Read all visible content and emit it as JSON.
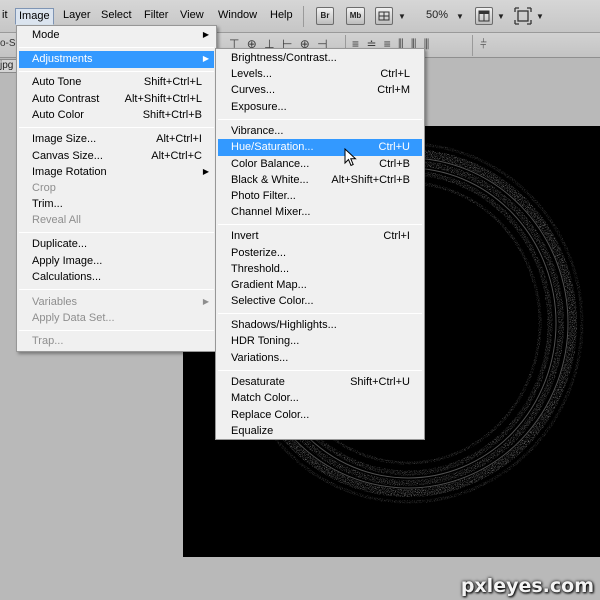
{
  "menubar": {
    "items": [
      "it",
      "Image",
      "Layer",
      "Select",
      "Filter",
      "View",
      "Window",
      "Help"
    ],
    "bridge_label": "Br",
    "minibridge_label": "Mb",
    "zoom": "50%"
  },
  "options_bar": {
    "left_fragment": "o-Se"
  },
  "doc_tab": {
    "label": "jpg"
  },
  "image_menu": {
    "rows": [
      {
        "label": "Mode",
        "shortcut": "",
        "submenu": true,
        "disabled": false,
        "highlighted": false
      },
      {
        "label": "Adjustments",
        "shortcut": "",
        "submenu": true,
        "disabled": false,
        "highlighted": true
      },
      {
        "label": "Auto Tone",
        "shortcut": "Shift+Ctrl+L",
        "submenu": false,
        "disabled": false,
        "highlighted": false
      },
      {
        "label": "Auto Contrast",
        "shortcut": "Alt+Shift+Ctrl+L",
        "submenu": false,
        "disabled": false,
        "highlighted": false
      },
      {
        "label": "Auto Color",
        "shortcut": "Shift+Ctrl+B",
        "submenu": false,
        "disabled": false,
        "highlighted": false
      },
      {
        "label": "Image Size...",
        "shortcut": "Alt+Ctrl+I",
        "submenu": false,
        "disabled": false,
        "highlighted": false
      },
      {
        "label": "Canvas Size...",
        "shortcut": "Alt+Ctrl+C",
        "submenu": false,
        "disabled": false,
        "highlighted": false
      },
      {
        "label": "Image Rotation",
        "shortcut": "",
        "submenu": true,
        "disabled": false,
        "highlighted": false
      },
      {
        "label": "Crop",
        "shortcut": "",
        "submenu": false,
        "disabled": true,
        "highlighted": false
      },
      {
        "label": "Trim...",
        "shortcut": "",
        "submenu": false,
        "disabled": false,
        "highlighted": false
      },
      {
        "label": "Reveal All",
        "shortcut": "",
        "submenu": false,
        "disabled": true,
        "highlighted": false
      },
      {
        "label": "Duplicate...",
        "shortcut": "",
        "submenu": false,
        "disabled": false,
        "highlighted": false
      },
      {
        "label": "Apply Image...",
        "shortcut": "",
        "submenu": false,
        "disabled": false,
        "highlighted": false
      },
      {
        "label": "Calculations...",
        "shortcut": "",
        "submenu": false,
        "disabled": false,
        "highlighted": false
      },
      {
        "label": "Variables",
        "shortcut": "",
        "submenu": true,
        "disabled": true,
        "highlighted": false
      },
      {
        "label": "Apply Data Set...",
        "shortcut": "",
        "submenu": false,
        "disabled": true,
        "highlighted": false
      },
      {
        "label": "Trap...",
        "shortcut": "",
        "submenu": false,
        "disabled": true,
        "highlighted": false
      }
    ]
  },
  "adjustments_menu": {
    "rows": [
      {
        "label": "Brightness/Contrast...",
        "shortcut": "",
        "highlighted": false
      },
      {
        "label": "Levels...",
        "shortcut": "Ctrl+L",
        "highlighted": false
      },
      {
        "label": "Curves...",
        "shortcut": "Ctrl+M",
        "highlighted": false
      },
      {
        "label": "Exposure...",
        "shortcut": "",
        "highlighted": false
      },
      {
        "label": "Vibrance...",
        "shortcut": "",
        "highlighted": false
      },
      {
        "label": "Hue/Saturation...",
        "shortcut": "Ctrl+U",
        "highlighted": true
      },
      {
        "label": "Color Balance...",
        "shortcut": "Ctrl+B",
        "highlighted": false
      },
      {
        "label": "Black & White...",
        "shortcut": "Alt+Shift+Ctrl+B",
        "highlighted": false
      },
      {
        "label": "Photo Filter...",
        "shortcut": "",
        "highlighted": false
      },
      {
        "label": "Channel Mixer...",
        "shortcut": "",
        "highlighted": false
      },
      {
        "label": "Invert",
        "shortcut": "Ctrl+I",
        "highlighted": false
      },
      {
        "label": "Posterize...",
        "shortcut": "",
        "highlighted": false
      },
      {
        "label": "Threshold...",
        "shortcut": "",
        "highlighted": false
      },
      {
        "label": "Gradient Map...",
        "shortcut": "",
        "highlighted": false
      },
      {
        "label": "Selective Color...",
        "shortcut": "",
        "highlighted": false
      },
      {
        "label": "Shadows/Highlights...",
        "shortcut": "",
        "highlighted": false
      },
      {
        "label": "HDR Toning...",
        "shortcut": "",
        "highlighted": false
      },
      {
        "label": "Variations...",
        "shortcut": "",
        "highlighted": false
      },
      {
        "label": "Desaturate",
        "shortcut": "Shift+Ctrl+U",
        "highlighted": false
      },
      {
        "label": "Match Color...",
        "shortcut": "",
        "highlighted": false
      },
      {
        "label": "Replace Color...",
        "shortcut": "",
        "highlighted": false
      },
      {
        "label": "Equalize",
        "shortcut": "",
        "highlighted": false
      }
    ]
  },
  "watermark": "pxleyes.com",
  "colors": {
    "highlight": "#3399ff",
    "canvas": "#000000",
    "workspace": "#b9b9b9"
  }
}
